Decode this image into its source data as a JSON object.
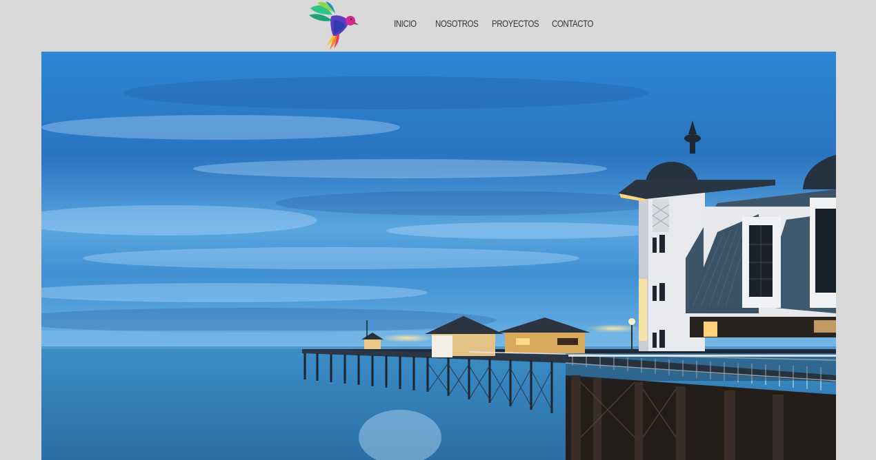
{
  "header": {
    "logo_icon": "hummingbird-logo-icon",
    "nav": [
      {
        "label": "INICIO"
      },
      {
        "label": "NOSOTROS"
      },
      {
        "label": "PROYECTOS"
      },
      {
        "label": "CONTACTO"
      }
    ]
  },
  "hero": {
    "image": "pier-at-dusk-photo"
  },
  "colors": {
    "background": "#d9d9d9",
    "nav_text": "#333333",
    "sky": "#2f78c0",
    "sea": "#2a6e9e"
  }
}
